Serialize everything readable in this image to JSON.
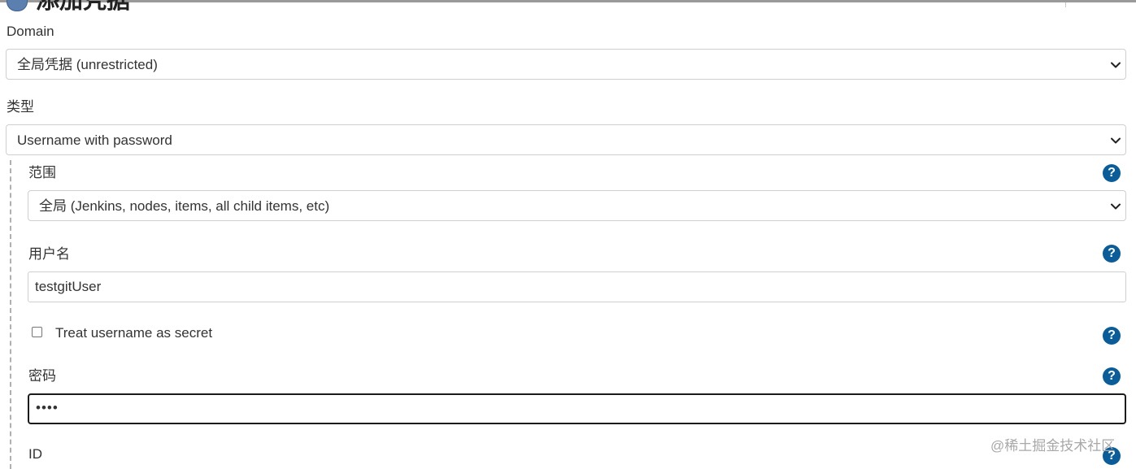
{
  "heading": {
    "title": "添加凭据"
  },
  "domain": {
    "label": "Domain",
    "selected": "全局凭据 (unrestricted)"
  },
  "kind": {
    "label": "类型",
    "selected": "Username with password"
  },
  "scope": {
    "label": "范围",
    "selected": "全局 (Jenkins, nodes, items, all child items, etc)",
    "help": "?"
  },
  "username": {
    "label": "用户名",
    "value": "testgitUser",
    "help": "?"
  },
  "treat_secret": {
    "label": "Treat username as secret",
    "checked": false,
    "help": "?"
  },
  "password": {
    "label": "密码",
    "value": "••••",
    "help": "?"
  },
  "id_field": {
    "label": "ID",
    "help": "?"
  },
  "watermark": "@稀土掘金技术社区",
  "colors": {
    "help_icon": "#0b5d9a",
    "border": "#cfcfcf",
    "focus_border": "#1b1b1b"
  }
}
